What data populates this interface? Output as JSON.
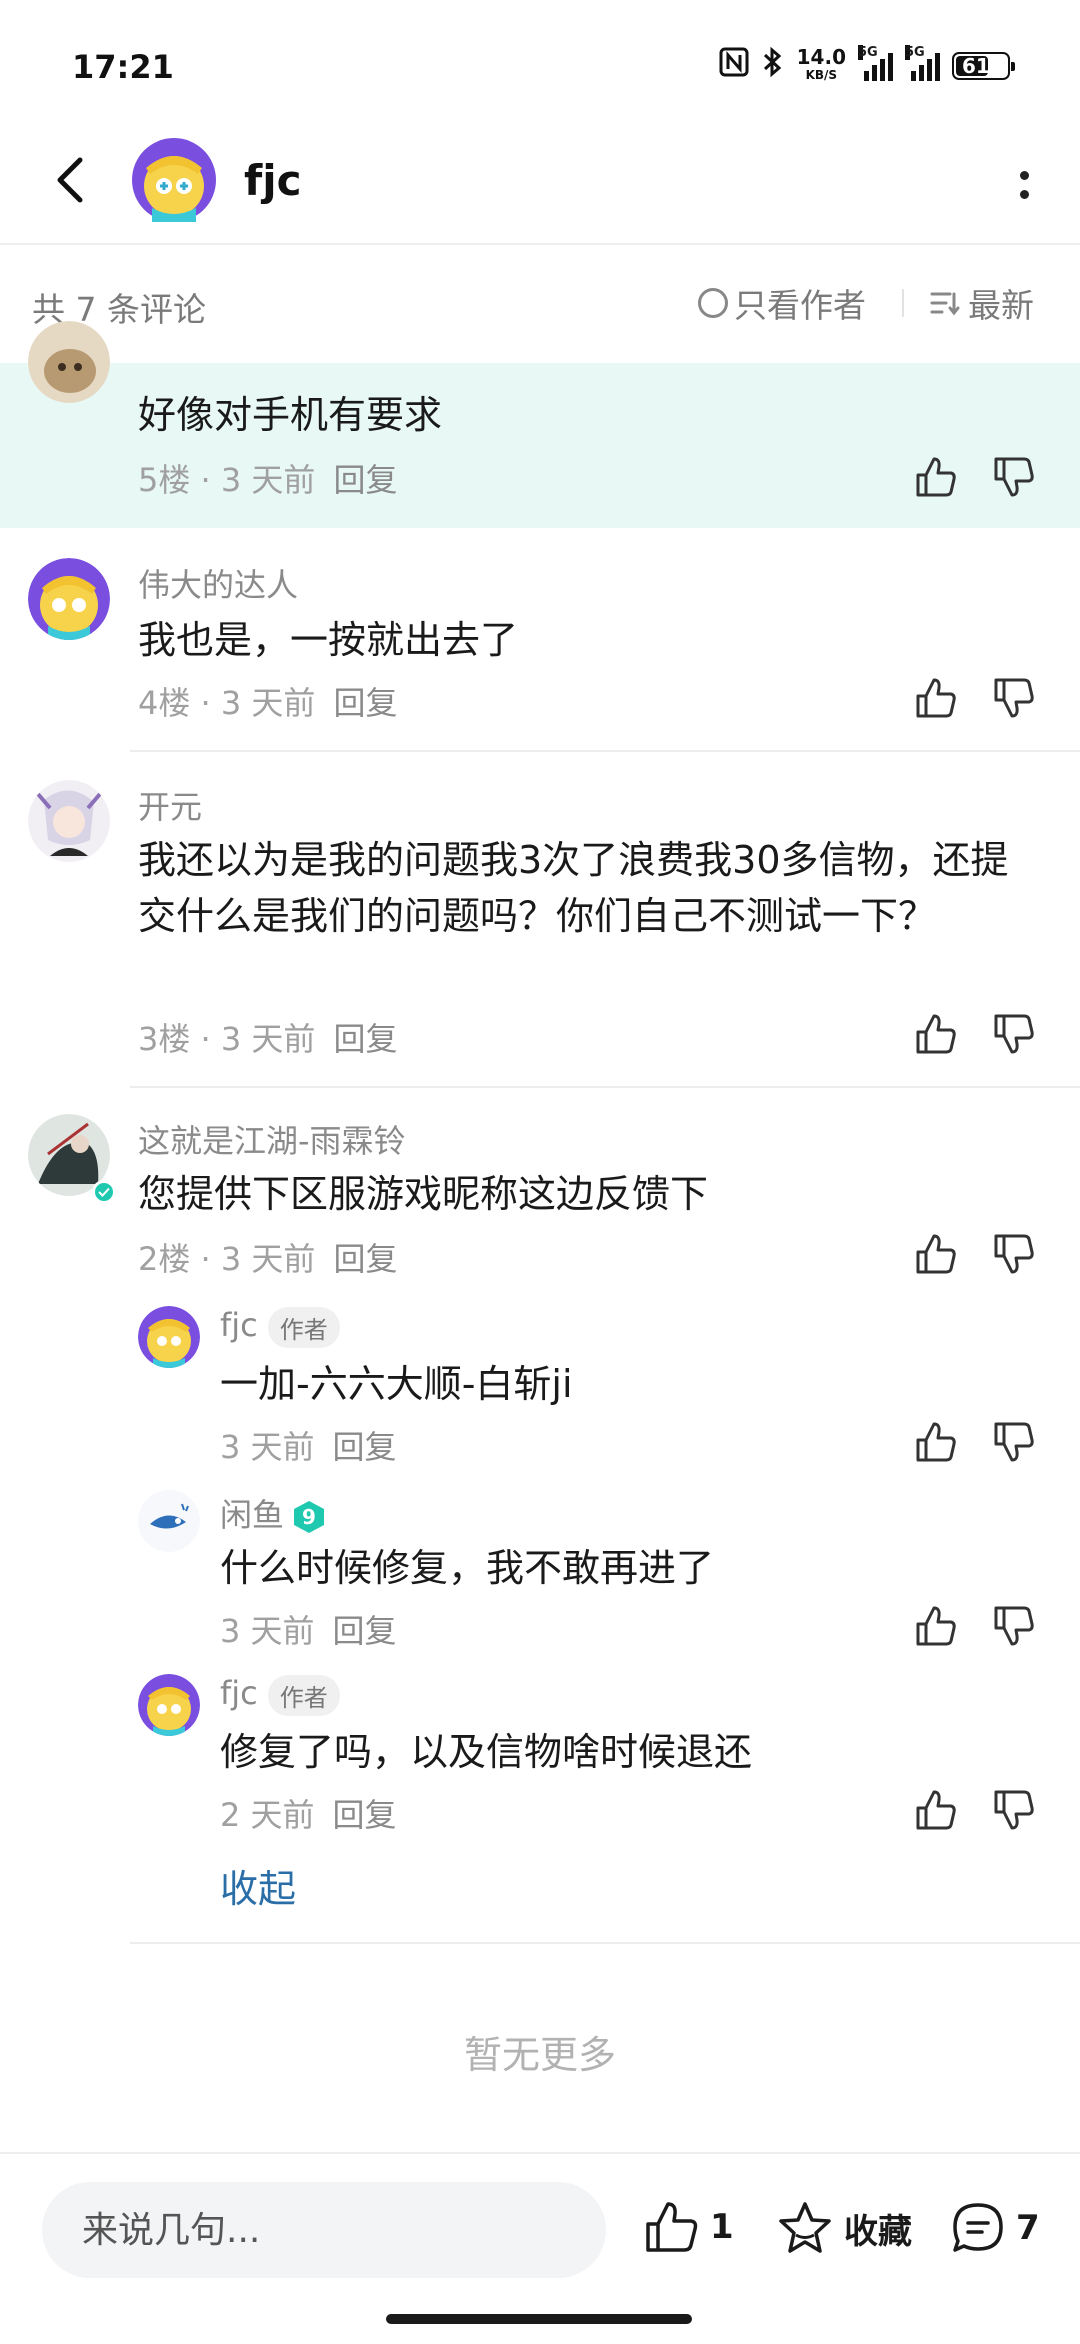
{
  "status_bar": {
    "time": "17:21",
    "net_speed": "14.0",
    "net_unit": "KB/S",
    "signal1_tag": "5G",
    "signal2_tag": "5G",
    "battery": "61"
  },
  "header": {
    "title": "fjc"
  },
  "filter": {
    "count_label": "共 7 条评论",
    "only_author_label": "只看作者",
    "sort_label": "最新"
  },
  "comments": [
    {
      "name": "",
      "text": "好像对手机有要求",
      "floor": "5楼",
      "time": "3 天前",
      "reply": "回复"
    },
    {
      "name": "伟大的达人",
      "text": "我也是，一按就出去了",
      "floor": "4楼",
      "time": "3 天前",
      "reply": "回复"
    },
    {
      "name": "开元",
      "text": "我还以为是我的问题我3次了浪费我30多信物，还提交什么是我们的问题吗？你们自己不测试一下？",
      "floor": "3楼",
      "time": "3 天前",
      "reply": "回复"
    },
    {
      "name": "这就是江湖-雨霖铃",
      "text": "您提供下区服游戏昵称这边反馈下",
      "floor": "2楼",
      "time": "3 天前",
      "reply": "回复"
    }
  ],
  "replies": [
    {
      "name": "fjc",
      "badge": "作者",
      "text": "一加-六六大顺-白斩ji",
      "time": "3 天前",
      "reply": "回复"
    },
    {
      "name": "闲鱼",
      "level": "9",
      "text": "什么时候修复，我不敢再进了",
      "time": "3 天前",
      "reply": "回复"
    },
    {
      "name": "fjc",
      "badge": "作者",
      "text": "修复了吗，以及信物啥时候退还",
      "time": "2 天前",
      "reply": "回复"
    }
  ],
  "collapse_label": "收起",
  "no_more_label": "暂无更多",
  "bottom_bar": {
    "input_placeholder": "来说几句...",
    "like_count": "1",
    "favorite_label": "收藏",
    "comment_count": "7"
  },
  "colors": {
    "accent": "#1fc9b0",
    "highlight_bg": "#e8f8f5",
    "link": "#2a6ea8"
  }
}
